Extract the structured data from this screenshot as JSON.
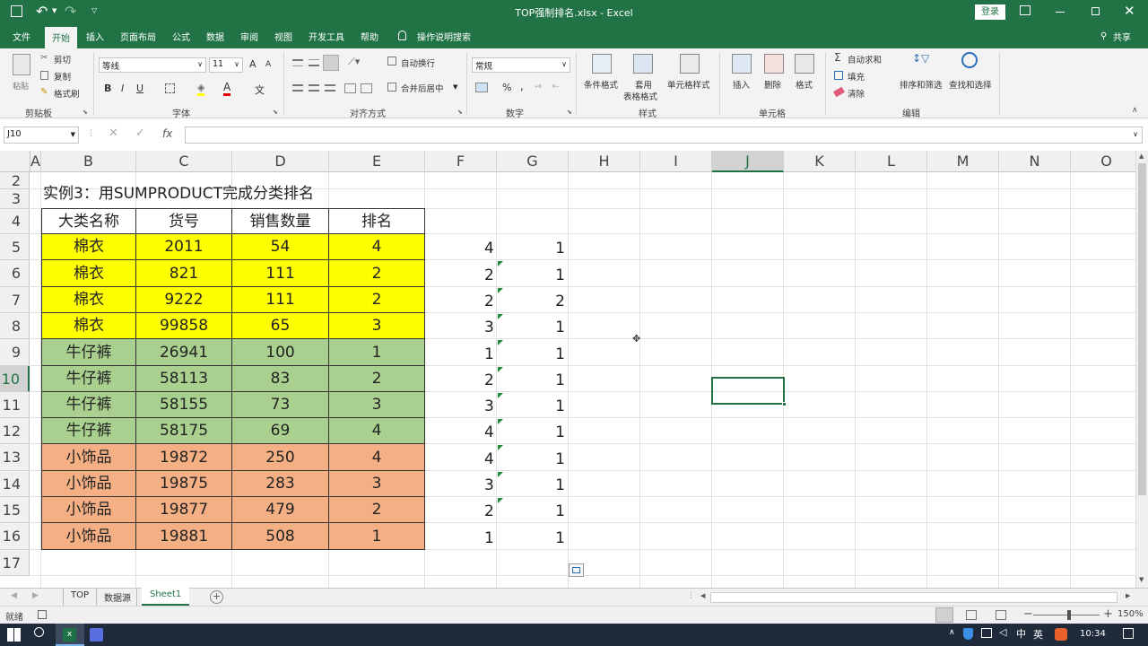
{
  "titlebar": {
    "title": "TOP强制排名.xlsx  -  Excel",
    "login_label": "登录"
  },
  "ribbon_tabs": [
    "文件",
    "开始",
    "插入",
    "页面布局",
    "公式",
    "数据",
    "审阅",
    "视图",
    "开发工具",
    "帮助"
  ],
  "tell_me": "操作说明搜索",
  "share_label": "共享",
  "ribbon": {
    "clipboard": {
      "paste": "粘贴",
      "cut": "剪切",
      "copy": "复制",
      "format_painter": "格式刷",
      "group": "剪贴板"
    },
    "font": {
      "name": "等线",
      "size": "11",
      "bold": "B",
      "italic": "I",
      "underline": "U",
      "grow": "A",
      "shrink": "A",
      "wen": "文",
      "group": "字体"
    },
    "alignment": {
      "wrap": "自动换行",
      "merge": "合并后居中",
      "group": "对齐方式"
    },
    "number": {
      "format": "常规",
      "percent": "%",
      "comma": ",",
      "group": "数字"
    },
    "styles": {
      "cond": "条件格式",
      "table_fmt_1": "套用",
      "table_fmt_2": "表格格式",
      "cell_styles": "单元格样式",
      "group": "样式"
    },
    "cells": {
      "insert": "插入",
      "delete": "删除",
      "format": "格式",
      "group": "单元格"
    },
    "editing": {
      "autosum": "自动求和",
      "fill": "填充",
      "clear": "清除",
      "sort": "排序和筛选",
      "find": "查找和选择",
      "group": "编辑"
    }
  },
  "formula_bar": {
    "name_box": "J10",
    "fx": "fx",
    "content": ""
  },
  "columns": [
    "A",
    "B",
    "C",
    "D",
    "E",
    "F",
    "G",
    "H",
    "I",
    "J",
    "K",
    "L",
    "M",
    "N",
    "O"
  ],
  "selected_column": "J",
  "selected_row": "10",
  "rows": [
    "2",
    "3",
    "4",
    "5",
    "6",
    "7",
    "8",
    "9",
    "10",
    "11",
    "12",
    "13",
    "14",
    "15",
    "16",
    "17"
  ],
  "heading": "实例3：用SUMPRODUCT完成分类排名",
  "table": {
    "headers": [
      "大类名称",
      "货号",
      "销售数量",
      "排名"
    ],
    "rows": [
      [
        "棉衣",
        "2011",
        "54",
        "4"
      ],
      [
        "棉衣",
        "821",
        "111",
        "2"
      ],
      [
        "棉衣",
        "9222",
        "111",
        "2"
      ],
      [
        "棉衣",
        "99858",
        "65",
        "3"
      ],
      [
        "牛仔裤",
        "26941",
        "100",
        "1"
      ],
      [
        "牛仔裤",
        "58113",
        "83",
        "2"
      ],
      [
        "牛仔裤",
        "58155",
        "73",
        "3"
      ],
      [
        "牛仔裤",
        "58175",
        "69",
        "4"
      ],
      [
        "小饰品",
        "19872",
        "250",
        "4"
      ],
      [
        "小饰品",
        "19875",
        "283",
        "3"
      ],
      [
        "小饰品",
        "19877",
        "479",
        "2"
      ],
      [
        "小饰品",
        "19881",
        "508",
        "1"
      ]
    ],
    "group_colors": [
      "#ffff00",
      "#a9d08e",
      "#f4b084"
    ]
  },
  "col_f": [
    "4",
    "2",
    "2",
    "3",
    "1",
    "2",
    "3",
    "4",
    "4",
    "3",
    "2",
    "1"
  ],
  "col_g": [
    "1",
    "1",
    "2",
    "1",
    "1",
    "1",
    "1",
    "1",
    "1",
    "1",
    "1",
    "1"
  ],
  "sheet_tabs": [
    "TOP",
    "数据源",
    "Sheet1"
  ],
  "active_sheet": "Sheet1",
  "status": {
    "ready": "就绪",
    "zoom": "150%"
  },
  "taskbar": {
    "ime": "英",
    "time": "10:34"
  },
  "colors": {
    "excel_green": "#217346"
  }
}
